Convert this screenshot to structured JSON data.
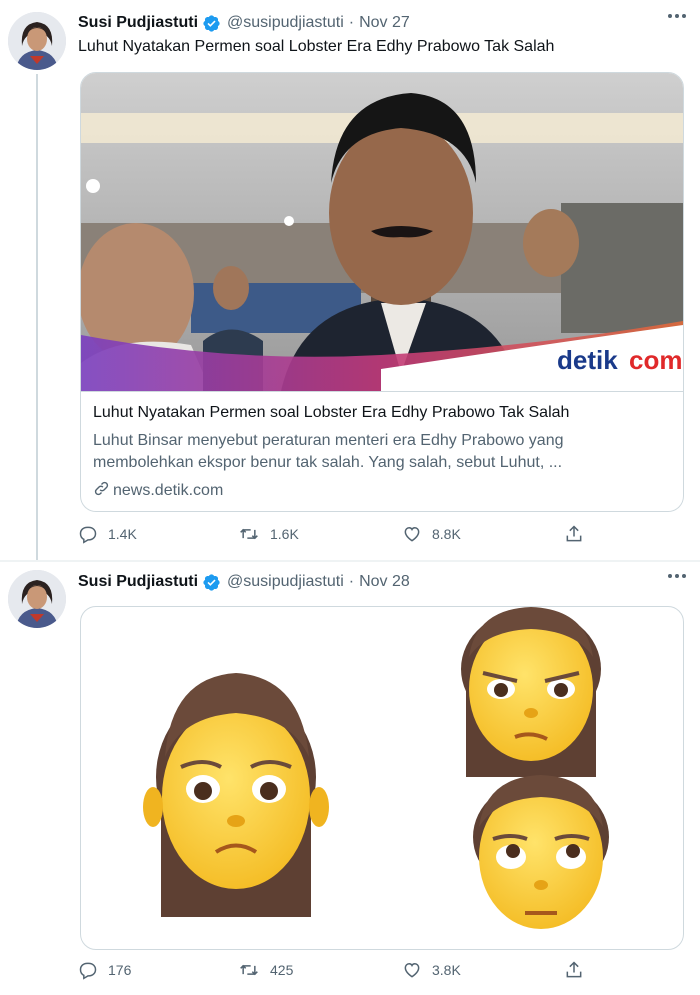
{
  "tweets": [
    {
      "author_name": "Susi Pudjiastuti",
      "handle": "@susipudjiastuti",
      "separator": "·",
      "date": "Nov 27",
      "text": "Luhut Nyatakan Permen soal Lobster Era Edhy Prabowo Tak Salah",
      "card": {
        "image_logo": "detikcom",
        "image_logo_part1": "detik",
        "image_logo_part2": "com",
        "title": "Luhut Nyatakan Permen soal Lobster Era Edhy Prabowo Tak Salah",
        "description": "Luhut Binsar menyebut peraturan menteri era Edhy Prabowo yang membolehkan ekspor benur tak salah. Yang salah, sebut Luhut, ...",
        "domain": "news.detik.com"
      },
      "stats": {
        "replies": "1.4K",
        "retweets": "1.6K",
        "likes": "8.8K"
      }
    },
    {
      "author_name": "Susi Pudjiastuti",
      "handle": "@susipudjiastuti",
      "separator": "·",
      "date": "Nov 28",
      "stats": {
        "replies": "176",
        "retweets": "425",
        "likes": "3.8K"
      }
    }
  ],
  "icons": {
    "verified": "verified-badge-icon",
    "more": "more-dots-icon",
    "reply": "reply-icon",
    "retweet": "retweet-icon",
    "like": "heart-icon",
    "share": "share-icon",
    "link": "link-icon"
  },
  "colors": {
    "verified_blue": "#1d9bf0",
    "text_primary": "#0f1419",
    "text_secondary": "#536471",
    "border": "#cfd9de",
    "detik_blue": "#1a3a8a",
    "detik_red": "#e0292a"
  }
}
